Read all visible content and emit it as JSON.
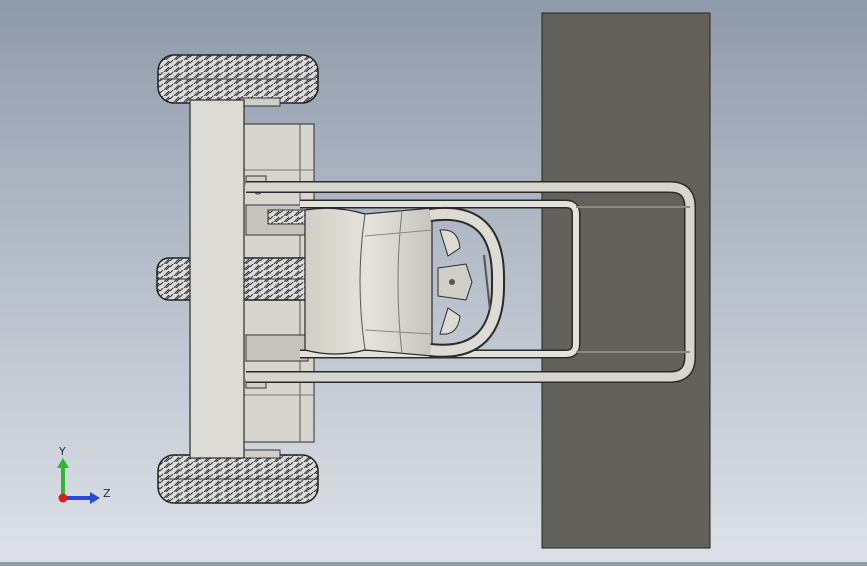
{
  "viewport": {
    "background_top": "#8f9aaa",
    "background_bottom": "#dde1e7"
  },
  "model": {
    "wall_panel_color": "#62625a",
    "part_color": "#dcdcd4",
    "edge_color": "#2a2a2a",
    "tire_color": "#d9d9d9"
  },
  "triad": {
    "y_label": "Y",
    "z_label": "Z",
    "y_color": "#2fb82f",
    "z_color": "#2a48d8",
    "origin_color": "#d42020"
  }
}
